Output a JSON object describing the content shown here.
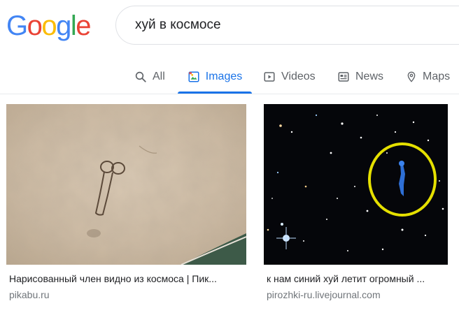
{
  "logo": {
    "letters": [
      "G",
      "o",
      "o",
      "g",
      "l",
      "e"
    ],
    "colors": [
      "#4285F4",
      "#EA4335",
      "#FBBC05",
      "#4285F4",
      "#34A853",
      "#EA4335"
    ]
  },
  "search": {
    "query": "хуй в космосе"
  },
  "tabs": [
    {
      "label": "All",
      "icon": "search-icon",
      "active": false
    },
    {
      "label": "Images",
      "icon": "image-icon",
      "active": true
    },
    {
      "label": "Videos",
      "icon": "video-icon",
      "active": false
    },
    {
      "label": "News",
      "icon": "news-icon",
      "active": false
    },
    {
      "label": "Maps",
      "icon": "map-pin-icon",
      "active": false
    }
  ],
  "accent_color": "#1a73e8",
  "results": [
    {
      "title": "Нарисованный член видно из космоса | Пик...",
      "source": "pikabu.ru"
    },
    {
      "title": "к нам синий хуй летит огромный ...",
      "source": "pirozhki-ru.livejournal.com"
    }
  ]
}
